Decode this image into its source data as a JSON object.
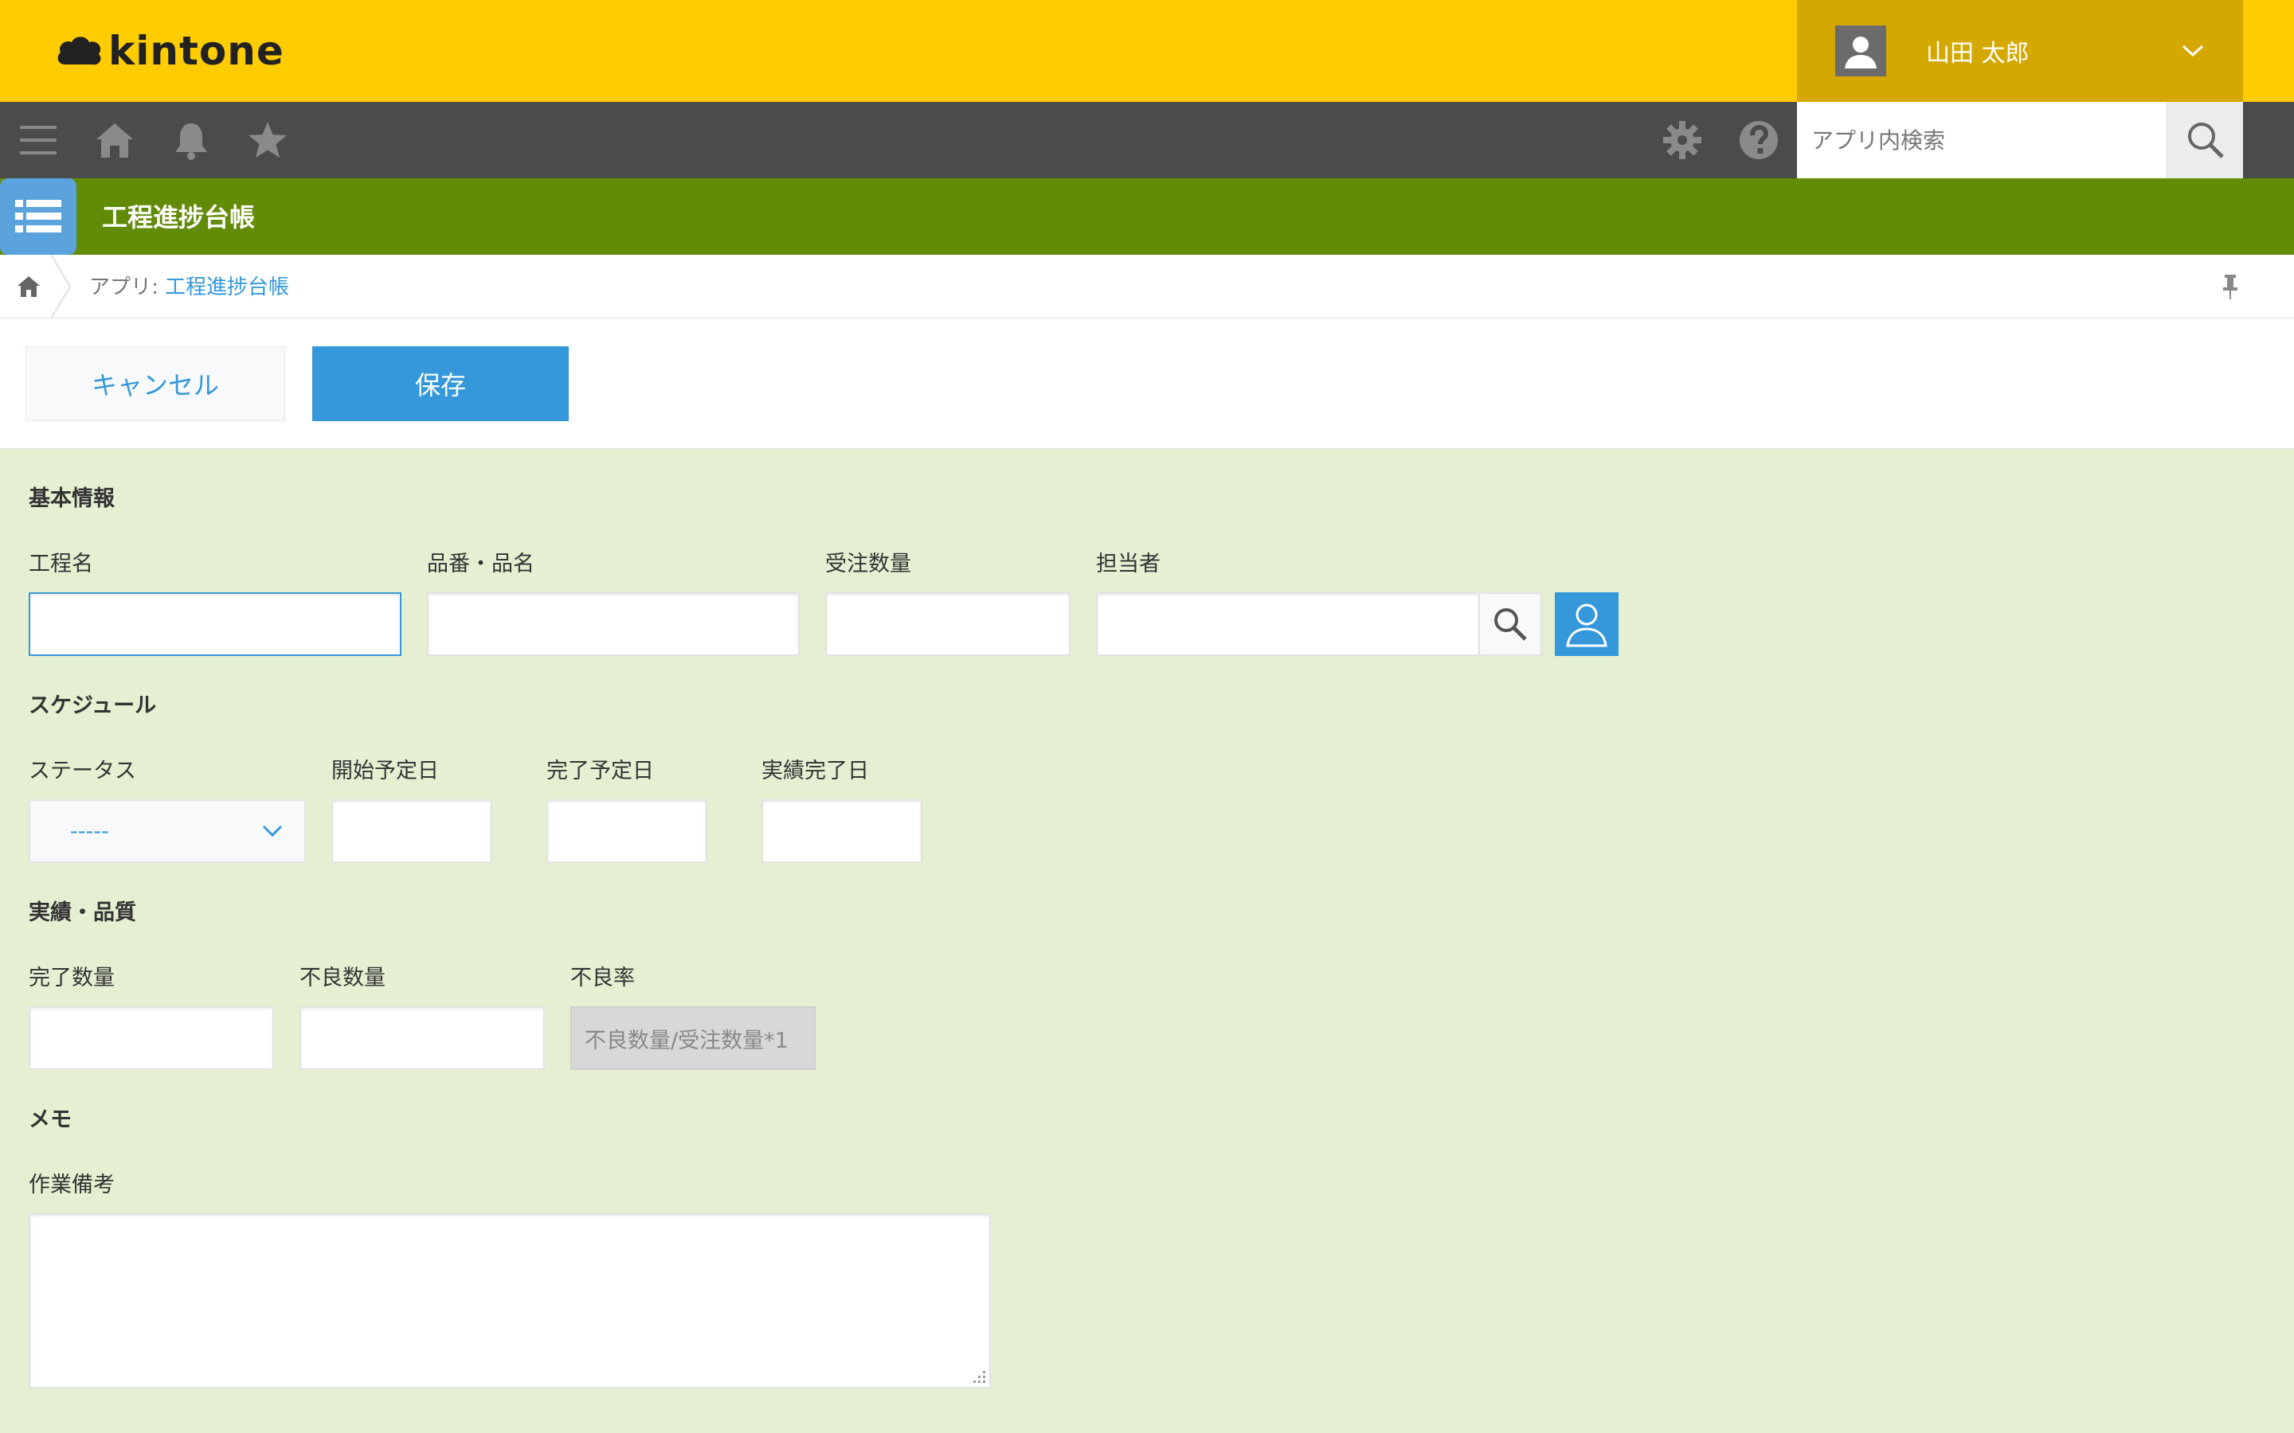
{
  "header": {
    "logo_text": "kintone",
    "user_name": "山田 太郎"
  },
  "toolbar": {
    "menu_icon": "hamburger-menu-icon",
    "home_icon": "home-icon",
    "notification_icon": "bell-icon",
    "favorites_icon": "star-icon",
    "settings_icon": "gear-icon",
    "help_icon": "help-icon",
    "search_placeholder": "アプリ内検索"
  },
  "app": {
    "title": "工程進捗台帳"
  },
  "breadcrumb": {
    "prefix": "アプリ: ",
    "link": "工程進捗台帳"
  },
  "actions": {
    "cancel_label": "キャンセル",
    "save_label": "保存"
  },
  "form": {
    "section_basic": "基本情報",
    "process_name_label": "工程名",
    "product_label": "品番・品名",
    "order_qty_label": "受注数量",
    "assignee_label": "担当者",
    "section_schedule": "スケジュール",
    "status_label": "ステータス",
    "status_value": "-----",
    "planned_start_label": "開始予定日",
    "planned_end_label": "完了予定日",
    "actual_end_label": "実績完了日",
    "section_results": "実績・品質",
    "completed_qty_label": "完了数量",
    "defect_qty_label": "不良数量",
    "defect_rate_label": "不良率",
    "defect_rate_formula": "不良数量/受注数量*1",
    "section_memo": "メモ",
    "work_notes_label": "作業備考"
  },
  "colors": {
    "header_yellow": "#ffcc00",
    "user_area": "#d4a800",
    "toolbar": "#4b4b4b",
    "app_bar_green": "#628b08",
    "accent_blue": "#3498db",
    "form_bg": "#e5f0d3"
  }
}
